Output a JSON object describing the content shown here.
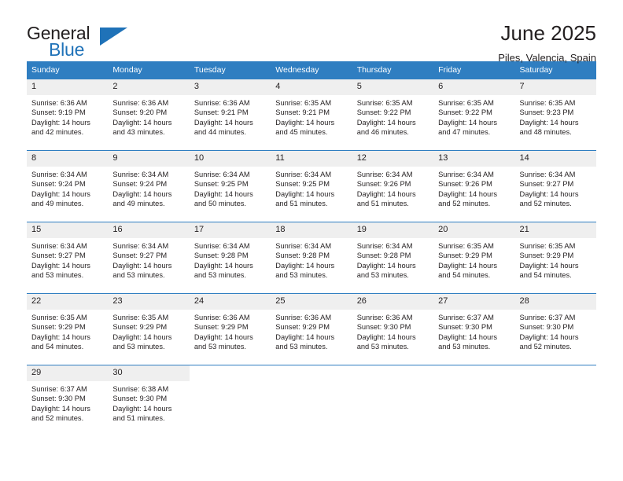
{
  "logo": {
    "primary_text": "General",
    "secondary_text": "Blue",
    "accent_color": "#1f72b8"
  },
  "header": {
    "title": "June 2025",
    "subtitle": "Piles, Valencia, Spain"
  },
  "calendar": {
    "header_color": "#2f7ec1",
    "daynum_background": "#efefef",
    "weekday_headers": [
      "Sunday",
      "Monday",
      "Tuesday",
      "Wednesday",
      "Thursday",
      "Friday",
      "Saturday"
    ],
    "weeks": [
      {
        "days": [
          {
            "num": "1",
            "sunrise": "Sunrise: 6:36 AM",
            "sunset": "Sunset: 9:19 PM",
            "daylight_line1": "Daylight: 14 hours",
            "daylight_line2": "and 42 minutes."
          },
          {
            "num": "2",
            "sunrise": "Sunrise: 6:36 AM",
            "sunset": "Sunset: 9:20 PM",
            "daylight_line1": "Daylight: 14 hours",
            "daylight_line2": "and 43 minutes."
          },
          {
            "num": "3",
            "sunrise": "Sunrise: 6:36 AM",
            "sunset": "Sunset: 9:21 PM",
            "daylight_line1": "Daylight: 14 hours",
            "daylight_line2": "and 44 minutes."
          },
          {
            "num": "4",
            "sunrise": "Sunrise: 6:35 AM",
            "sunset": "Sunset: 9:21 PM",
            "daylight_line1": "Daylight: 14 hours",
            "daylight_line2": "and 45 minutes."
          },
          {
            "num": "5",
            "sunrise": "Sunrise: 6:35 AM",
            "sunset": "Sunset: 9:22 PM",
            "daylight_line1": "Daylight: 14 hours",
            "daylight_line2": "and 46 minutes."
          },
          {
            "num": "6",
            "sunrise": "Sunrise: 6:35 AM",
            "sunset": "Sunset: 9:22 PM",
            "daylight_line1": "Daylight: 14 hours",
            "daylight_line2": "and 47 minutes."
          },
          {
            "num": "7",
            "sunrise": "Sunrise: 6:35 AM",
            "sunset": "Sunset: 9:23 PM",
            "daylight_line1": "Daylight: 14 hours",
            "daylight_line2": "and 48 minutes."
          }
        ]
      },
      {
        "days": [
          {
            "num": "8",
            "sunrise": "Sunrise: 6:34 AM",
            "sunset": "Sunset: 9:24 PM",
            "daylight_line1": "Daylight: 14 hours",
            "daylight_line2": "and 49 minutes."
          },
          {
            "num": "9",
            "sunrise": "Sunrise: 6:34 AM",
            "sunset": "Sunset: 9:24 PM",
            "daylight_line1": "Daylight: 14 hours",
            "daylight_line2": "and 49 minutes."
          },
          {
            "num": "10",
            "sunrise": "Sunrise: 6:34 AM",
            "sunset": "Sunset: 9:25 PM",
            "daylight_line1": "Daylight: 14 hours",
            "daylight_line2": "and 50 minutes."
          },
          {
            "num": "11",
            "sunrise": "Sunrise: 6:34 AM",
            "sunset": "Sunset: 9:25 PM",
            "daylight_line1": "Daylight: 14 hours",
            "daylight_line2": "and 51 minutes."
          },
          {
            "num": "12",
            "sunrise": "Sunrise: 6:34 AM",
            "sunset": "Sunset: 9:26 PM",
            "daylight_line1": "Daylight: 14 hours",
            "daylight_line2": "and 51 minutes."
          },
          {
            "num": "13",
            "sunrise": "Sunrise: 6:34 AM",
            "sunset": "Sunset: 9:26 PM",
            "daylight_line1": "Daylight: 14 hours",
            "daylight_line2": "and 52 minutes."
          },
          {
            "num": "14",
            "sunrise": "Sunrise: 6:34 AM",
            "sunset": "Sunset: 9:27 PM",
            "daylight_line1": "Daylight: 14 hours",
            "daylight_line2": "and 52 minutes."
          }
        ]
      },
      {
        "days": [
          {
            "num": "15",
            "sunrise": "Sunrise: 6:34 AM",
            "sunset": "Sunset: 9:27 PM",
            "daylight_line1": "Daylight: 14 hours",
            "daylight_line2": "and 53 minutes."
          },
          {
            "num": "16",
            "sunrise": "Sunrise: 6:34 AM",
            "sunset": "Sunset: 9:27 PM",
            "daylight_line1": "Daylight: 14 hours",
            "daylight_line2": "and 53 minutes."
          },
          {
            "num": "17",
            "sunrise": "Sunrise: 6:34 AM",
            "sunset": "Sunset: 9:28 PM",
            "daylight_line1": "Daylight: 14 hours",
            "daylight_line2": "and 53 minutes."
          },
          {
            "num": "18",
            "sunrise": "Sunrise: 6:34 AM",
            "sunset": "Sunset: 9:28 PM",
            "daylight_line1": "Daylight: 14 hours",
            "daylight_line2": "and 53 minutes."
          },
          {
            "num": "19",
            "sunrise": "Sunrise: 6:34 AM",
            "sunset": "Sunset: 9:28 PM",
            "daylight_line1": "Daylight: 14 hours",
            "daylight_line2": "and 53 minutes."
          },
          {
            "num": "20",
            "sunrise": "Sunrise: 6:35 AM",
            "sunset": "Sunset: 9:29 PM",
            "daylight_line1": "Daylight: 14 hours",
            "daylight_line2": "and 54 minutes."
          },
          {
            "num": "21",
            "sunrise": "Sunrise: 6:35 AM",
            "sunset": "Sunset: 9:29 PM",
            "daylight_line1": "Daylight: 14 hours",
            "daylight_line2": "and 54 minutes."
          }
        ]
      },
      {
        "days": [
          {
            "num": "22",
            "sunrise": "Sunrise: 6:35 AM",
            "sunset": "Sunset: 9:29 PM",
            "daylight_line1": "Daylight: 14 hours",
            "daylight_line2": "and 54 minutes."
          },
          {
            "num": "23",
            "sunrise": "Sunrise: 6:35 AM",
            "sunset": "Sunset: 9:29 PM",
            "daylight_line1": "Daylight: 14 hours",
            "daylight_line2": "and 53 minutes."
          },
          {
            "num": "24",
            "sunrise": "Sunrise: 6:36 AM",
            "sunset": "Sunset: 9:29 PM",
            "daylight_line1": "Daylight: 14 hours",
            "daylight_line2": "and 53 minutes."
          },
          {
            "num": "25",
            "sunrise": "Sunrise: 6:36 AM",
            "sunset": "Sunset: 9:29 PM",
            "daylight_line1": "Daylight: 14 hours",
            "daylight_line2": "and 53 minutes."
          },
          {
            "num": "26",
            "sunrise": "Sunrise: 6:36 AM",
            "sunset": "Sunset: 9:30 PM",
            "daylight_line1": "Daylight: 14 hours",
            "daylight_line2": "and 53 minutes."
          },
          {
            "num": "27",
            "sunrise": "Sunrise: 6:37 AM",
            "sunset": "Sunset: 9:30 PM",
            "daylight_line1": "Daylight: 14 hours",
            "daylight_line2": "and 53 minutes."
          },
          {
            "num": "28",
            "sunrise": "Sunrise: 6:37 AM",
            "sunset": "Sunset: 9:30 PM",
            "daylight_line1": "Daylight: 14 hours",
            "daylight_line2": "and 52 minutes."
          }
        ]
      },
      {
        "days": [
          {
            "num": "29",
            "sunrise": "Sunrise: 6:37 AM",
            "sunset": "Sunset: 9:30 PM",
            "daylight_line1": "Daylight: 14 hours",
            "daylight_line2": "and 52 minutes."
          },
          {
            "num": "30",
            "sunrise": "Sunrise: 6:38 AM",
            "sunset": "Sunset: 9:30 PM",
            "daylight_line1": "Daylight: 14 hours",
            "daylight_line2": "and 51 minutes."
          },
          {
            "num": "",
            "sunrise": "",
            "sunset": "",
            "daylight_line1": "",
            "daylight_line2": ""
          },
          {
            "num": "",
            "sunrise": "",
            "sunset": "",
            "daylight_line1": "",
            "daylight_line2": ""
          },
          {
            "num": "",
            "sunrise": "",
            "sunset": "",
            "daylight_line1": "",
            "daylight_line2": ""
          },
          {
            "num": "",
            "sunrise": "",
            "sunset": "",
            "daylight_line1": "",
            "daylight_line2": ""
          },
          {
            "num": "",
            "sunrise": "",
            "sunset": "",
            "daylight_line1": "",
            "daylight_line2": ""
          }
        ]
      }
    ]
  }
}
